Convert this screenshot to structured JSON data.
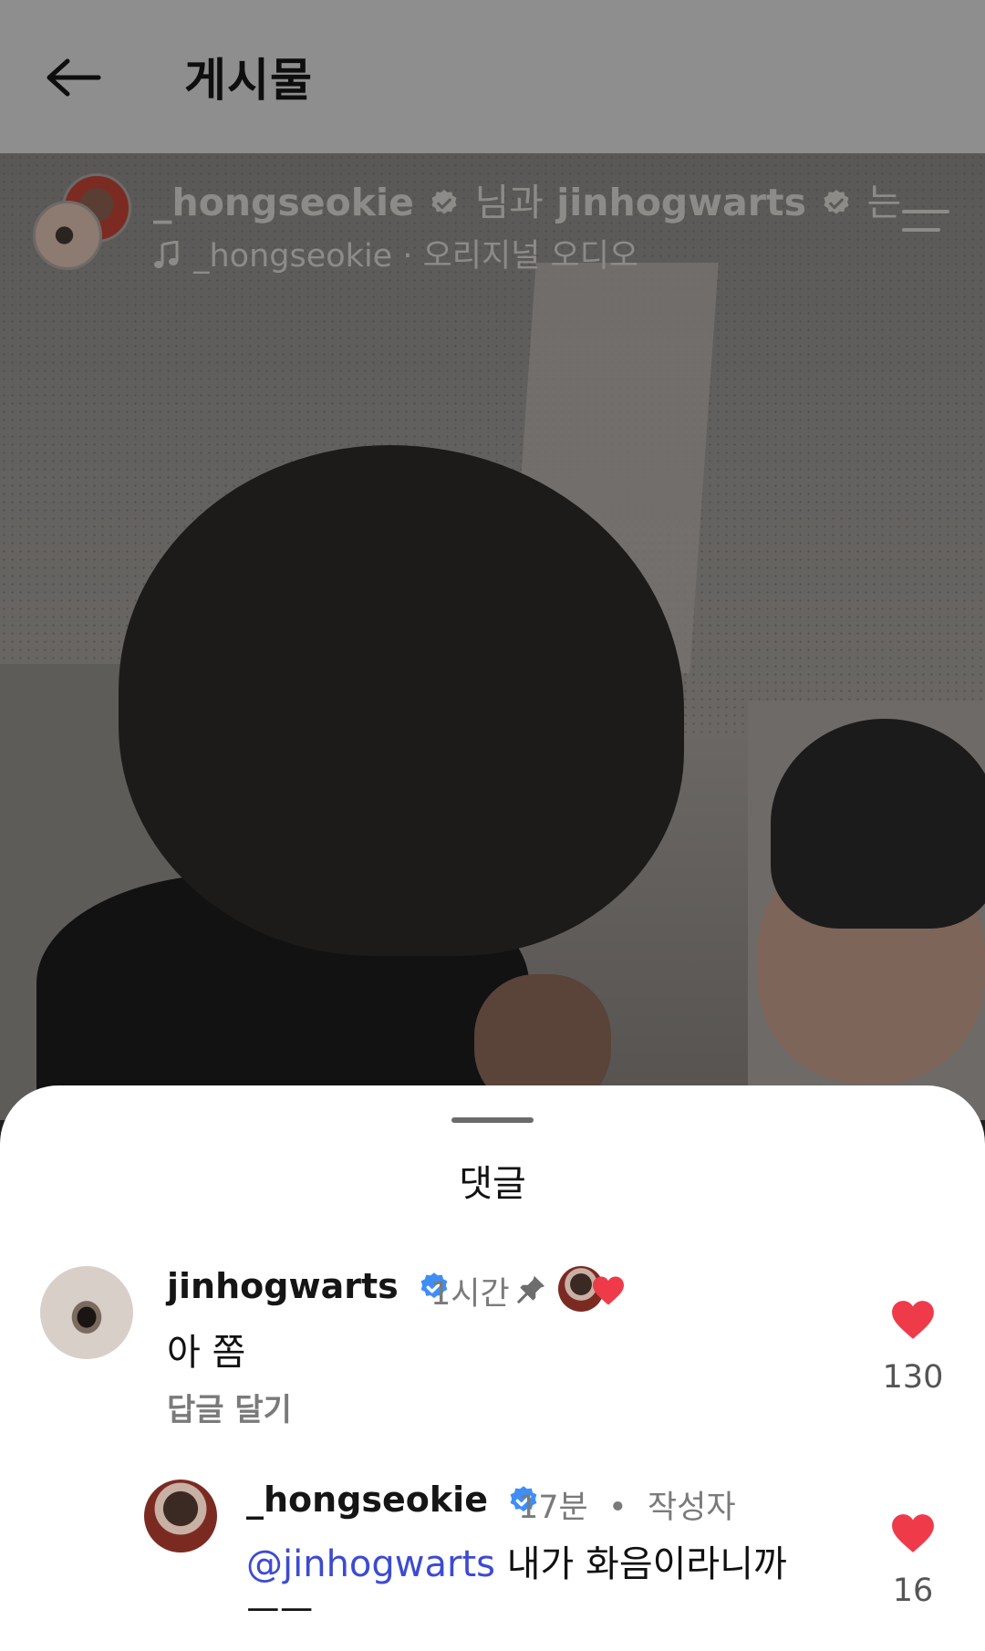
{
  "app_bar": {
    "title": "게시물",
    "back_icon": "arrow-left-icon"
  },
  "post_header": {
    "author_1": "_hongseokie",
    "joiner": "님과",
    "author_2": "jinhogwarts",
    "trail": "는",
    "audio": "_hongseokie · 오리지널 오디오",
    "audio_icon": "music-note-icon",
    "menu_icon": "menu-icon"
  },
  "comments_sheet": {
    "title": "댓글",
    "comments": [
      {
        "username": "jinhogwarts",
        "time": "1시간",
        "text": "아 쫌",
        "reply_label": "답글 달기",
        "likes": "130",
        "pinned_icon": "pin-icon",
        "creator_liked_icon": "creator-heart-icon"
      },
      {
        "username": "_hongseokie",
        "time": "17분",
        "author_label": "작성자",
        "mention": "@jinhogwarts",
        "text": " 내가 화음이라니까",
        "text_line2": "ㅡㅡ",
        "likes": "16"
      }
    ]
  },
  "colors": {
    "heart_red": "#ef3a4a",
    "verified_blue": "#3f8ef5",
    "mention_blue": "#3d4bd0"
  }
}
